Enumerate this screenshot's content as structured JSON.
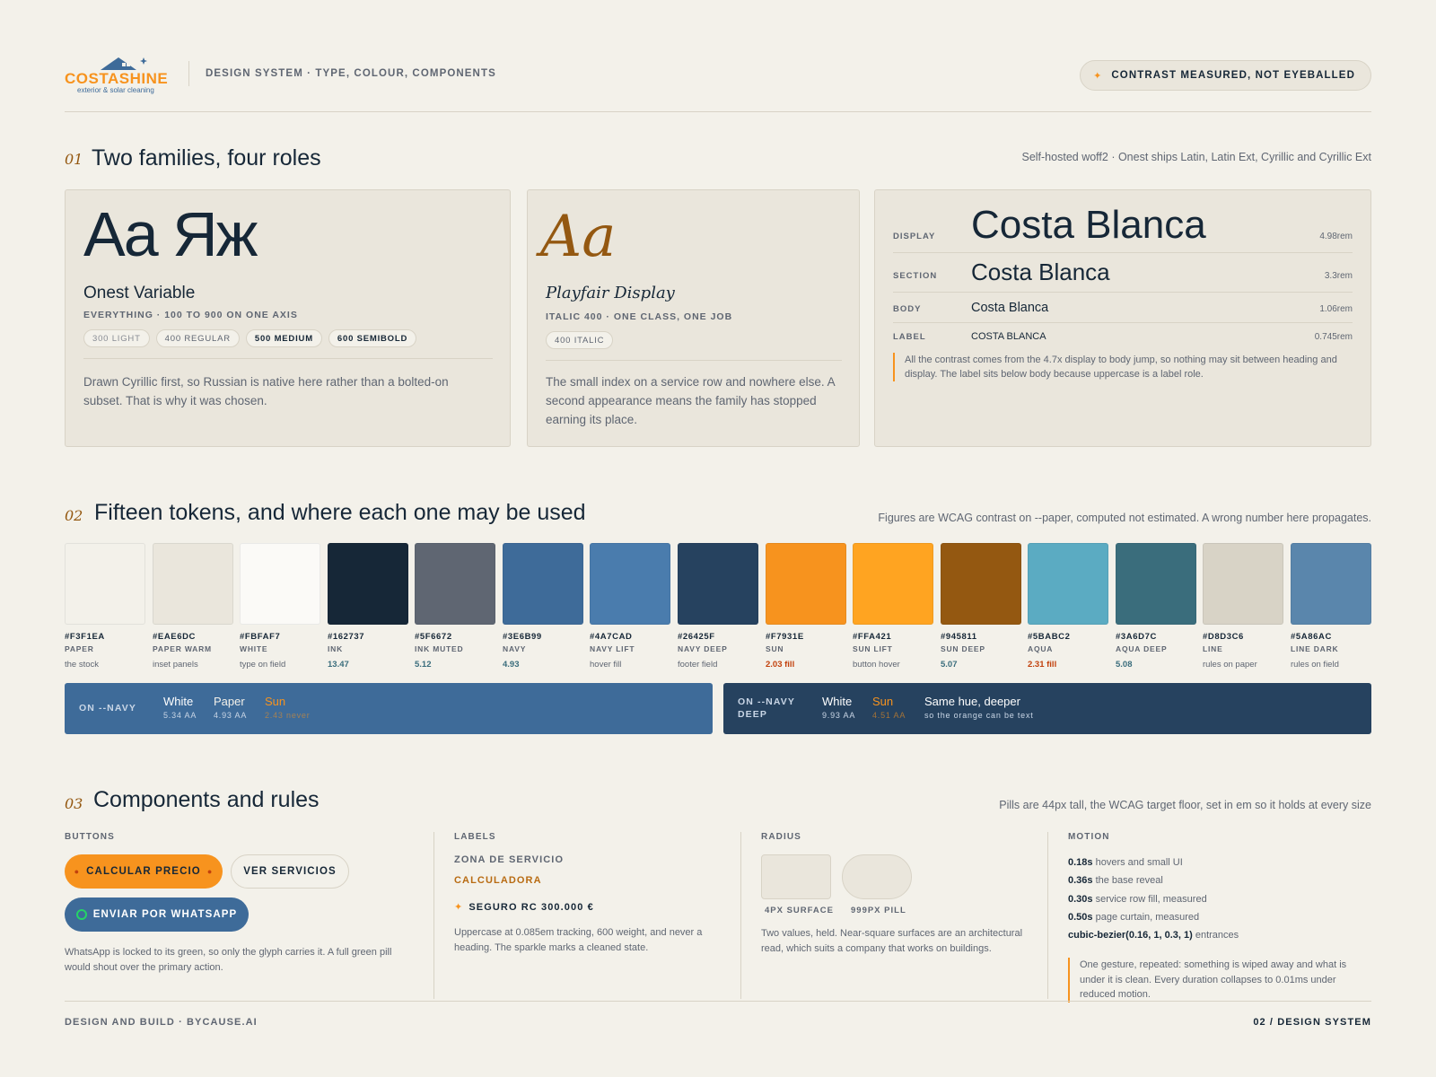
{
  "header": {
    "logo_word": "COSTASHINE",
    "logo_tagline": "exterior & solar cleaning",
    "subtitle": "DESIGN SYSTEM · TYPE, COLOUR, COMPONENTS",
    "badge": "CONTRAST MEASURED, NOT EYEBALLED",
    "badge_icon": "sparkle-icon"
  },
  "section1": {
    "num": "01",
    "title": "Two families, four roles",
    "note": "Self-hosted woff2 · Onest ships Latin, Latin Ext, Cyrillic and Cyrillic Ext",
    "sans": {
      "specimen": "Aa Яж",
      "name": "Onest Variable",
      "meta": "EVERYTHING · 100 TO 900 ON ONE AXIS",
      "weights": [
        "300 LIGHT",
        "400 REGULAR",
        "500 MEDIUM",
        "600 SEMIBOLD"
      ],
      "body": "Drawn Cyrillic first, so Russian is native here rather than a bolted-on subset. That is why it was chosen."
    },
    "serif": {
      "specimen": "Aa",
      "name": "Playfair Display",
      "meta": "ITALIC 400 · ONE CLASS, ONE JOB",
      "weights": [
        "400 ITALIC"
      ],
      "body": "The small index on a service row and nowhere else. A second appearance means the family has stopped earning its place."
    },
    "scale": {
      "rows": [
        {
          "label": "DISPLAY",
          "sample": "Costa Blanca",
          "size": "4.98rem"
        },
        {
          "label": "SECTION",
          "sample": "Costa Blanca",
          "size": "3.3rem"
        },
        {
          "label": "BODY",
          "sample": "Costa Blanca",
          "size": "1.06rem"
        },
        {
          "label": "LABEL",
          "sample": "COSTA BLANCA",
          "size": "0.745rem"
        }
      ],
      "note": "All the contrast comes from the 4.7x display to body jump, so nothing may sit between heading and display. The label sits below body because uppercase is a label role."
    }
  },
  "section2": {
    "num": "02",
    "title": "Fifteen tokens, and where each one may be used",
    "note": "Figures are WCAG contrast on --paper, computed not estimated. A wrong number here propagates.",
    "tokens": [
      {
        "hex": "#F3F1EA",
        "name": "PAPER",
        "use": "the stock",
        "kind": "text"
      },
      {
        "hex": "#EAE6DC",
        "name": "PAPER WARM",
        "use": "inset panels",
        "kind": "text"
      },
      {
        "hex": "#FBFAF7",
        "name": "WHITE",
        "use": "type on field",
        "kind": "text"
      },
      {
        "hex": "#162737",
        "name": "INK",
        "use": "13.47",
        "kind": "num"
      },
      {
        "hex": "#5F6672",
        "name": "INK MUTED",
        "use": "5.12",
        "kind": "num"
      },
      {
        "hex": "#3E6B99",
        "name": "NAVY",
        "use": "4.93",
        "kind": "num"
      },
      {
        "hex": "#4A7CAD",
        "name": "NAVY LIFT",
        "use": "hover fill",
        "kind": "text"
      },
      {
        "hex": "#26425F",
        "name": "NAVY DEEP",
        "use": "footer field",
        "kind": "text"
      },
      {
        "hex": "#F7931E",
        "name": "SUN",
        "use": "2.03 fill",
        "kind": "warn"
      },
      {
        "hex": "#FFA421",
        "name": "SUN LIFT",
        "use": "button hover",
        "kind": "text"
      },
      {
        "hex": "#945811",
        "name": "SUN DEEP",
        "use": "5.07",
        "kind": "num"
      },
      {
        "hex": "#5BABC2",
        "name": "AQUA",
        "use": "2.31 fill",
        "kind": "warn"
      },
      {
        "hex": "#3A6D7C",
        "name": "AQUA DEEP",
        "use": "5.08",
        "kind": "num"
      },
      {
        "hex": "#D8D3C6",
        "name": "LINE",
        "use": "rules on paper",
        "kind": "text"
      },
      {
        "hex": "#5A86AC",
        "name": "LINE DARK",
        "use": "rules on field",
        "kind": "text"
      }
    ],
    "on_navy": {
      "label": "ON --NAVY",
      "items": [
        {
          "title": "White",
          "sub": "5.34 AA",
          "color": "#FFFFFF"
        },
        {
          "title": "Paper",
          "sub": "4.93 AA",
          "color": "#F3F1EA"
        },
        {
          "title": "Sun",
          "sub": "2.43 never",
          "color": "#F7931E"
        }
      ]
    },
    "on_navy_deep": {
      "label_line1": "ON --NAVY",
      "label_line2": "DEEP",
      "items": [
        {
          "title": "White",
          "sub": "9.93 AA",
          "color": "#FFFFFF"
        },
        {
          "title": "Sun",
          "sub": "4.51 AA",
          "color": "#F7931E"
        },
        {
          "title": "Same hue, deeper",
          "sub": "so the orange can be text",
          "color": "#FFFFFF"
        }
      ]
    }
  },
  "section3": {
    "num": "03",
    "title": "Components and rules",
    "note": "Pills are 44px tall, the WCAG target floor, set in em so it holds at every size",
    "buttons": {
      "heading": "BUTTONS",
      "primary": "CALCULAR PRECIO",
      "ghost": "VER SERVICIOS",
      "whatsapp": "ENVIAR POR WHATSAPP",
      "note": "WhatsApp is locked to its green, so only the glyph carries it. A full green pill would shout over the primary action."
    },
    "labels": {
      "heading": "LABELS",
      "a": "ZONA DE SERVICIO",
      "b": "CALCULADORA",
      "c": "SEGURO RC 300.000 €",
      "note": "Uppercase at 0.085em tracking, 600 weight, and never a heading. The sparkle marks a cleaned state."
    },
    "radius": {
      "heading": "RADIUS",
      "a": "4PX SURFACE",
      "b": "999PX PILL",
      "note": "Two values, held. Near-square surfaces are an architectural read, which suits a company that works on buildings."
    },
    "motion": {
      "heading": "MOTION",
      "rows": [
        {
          "value": "0.18s",
          "text": " hovers and small UI"
        },
        {
          "value": "0.36s",
          "text": " the base reveal"
        },
        {
          "value": "0.30s",
          "text": " service row fill, measured"
        },
        {
          "value": "0.50s",
          "text": " page curtain, measured"
        },
        {
          "value": "cubic-bezier(0.16, 1, 0.3, 1)",
          "text": " entrances"
        }
      ],
      "note": "One gesture, repeated: something is wiped away and what is under it is clean. Every duration collapses to 0.01ms under reduced motion."
    }
  },
  "footer": {
    "left": "DESIGN AND BUILD · BYCAUSE.AI",
    "right": "02 / DESIGN SYSTEM"
  }
}
